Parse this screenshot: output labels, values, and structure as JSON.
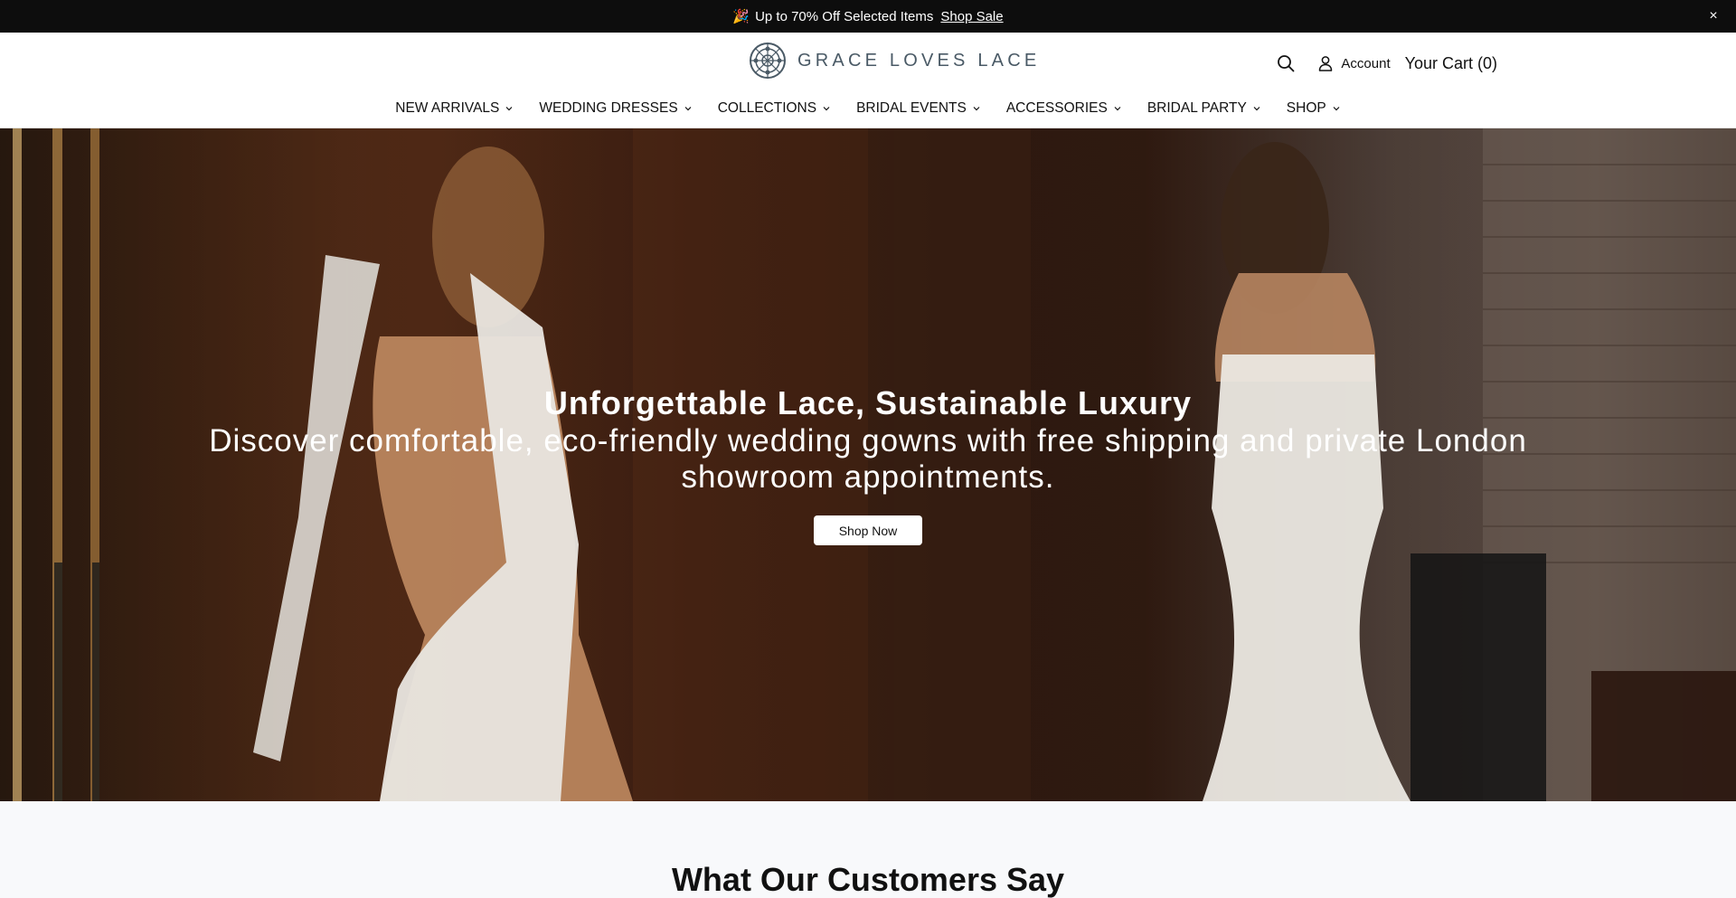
{
  "announcement": {
    "emoji": "🎉",
    "text": "Up to 70% Off Selected Items",
    "link": "Shop Sale",
    "close": "×"
  },
  "header": {
    "logo_text": "GRACE LOVES LACE",
    "account_label": "Account",
    "cart_label": "Your Cart (0)"
  },
  "nav": {
    "items": [
      {
        "label": "NEW ARRIVALS"
      },
      {
        "label": "WEDDING DRESSES"
      },
      {
        "label": "COLLECTIONS"
      },
      {
        "label": "BRIDAL EVENTS"
      },
      {
        "label": "ACCESSORIES"
      },
      {
        "label": "BRIDAL PARTY"
      },
      {
        "label": "SHOP"
      }
    ]
  },
  "hero": {
    "title": "Unforgettable Lace, Sustainable Luxury",
    "subtitle": "Discover comfortable, eco-friendly wedding gowns with free shipping and private London showroom appointments.",
    "cta": "Shop Now"
  },
  "reviews": {
    "title": "What Our Customers Say"
  },
  "colors": {
    "announcement_bg": "#0d0d0d",
    "logo": "#4a5a66",
    "button_bg": "#ffffff"
  }
}
